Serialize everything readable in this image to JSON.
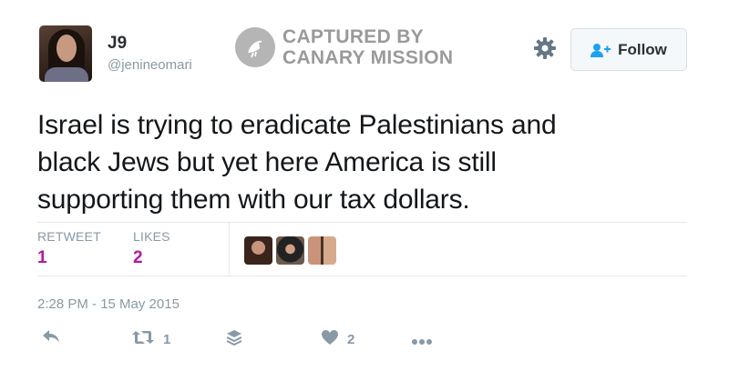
{
  "user": {
    "display_name": "J9",
    "screen_name": "@jenineomari"
  },
  "watermark": {
    "line1": "CAPTURED BY",
    "line2": "CANARY MISSION"
  },
  "follow_button": {
    "label": "Follow"
  },
  "tweet": {
    "line1": "Israel is trying to eradicate Palestinians and",
    "line2": "black Jews but yet here America is still",
    "line3": "supporting them with our tax dollars."
  },
  "stats": {
    "retweets_label": "RETWEET",
    "retweets_value": "1",
    "likes_label": "LIKES",
    "likes_value": "2"
  },
  "timestamp": "2:28 PM - 15 May 2015",
  "actions": {
    "retweet_count": "1",
    "like_count": "2"
  },
  "colors": {
    "accent_stat": "#b4189b",
    "muted": "#8899a6",
    "follow_icon": "#1da1f2"
  },
  "icons": [
    "reply-icon",
    "retweet-icon",
    "buffer-icon",
    "heart-icon",
    "more-icon",
    "gear-icon",
    "follow-person-icon",
    "canary-icon"
  ]
}
